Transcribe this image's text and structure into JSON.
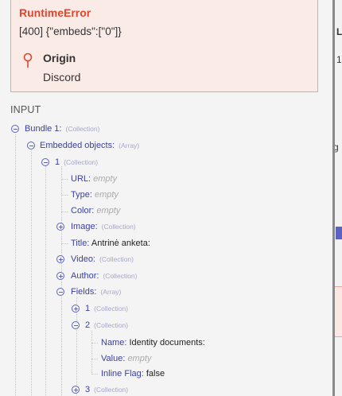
{
  "error": {
    "title": "RuntimeError",
    "message": "[400] {\"embeds\":[\"0\"]}",
    "origin_label": "Origin",
    "origin_value": "Discord",
    "accent_color": "#e0452d"
  },
  "input_label": "INPUT",
  "tree": {
    "bundle": {
      "key": "Bundle 1:",
      "type": "(Collection)"
    },
    "embedded": {
      "key": "Embedded objects:",
      "type": "(Array)"
    },
    "item1": {
      "key": "1",
      "type": "(Collection)"
    },
    "url": {
      "key": "URL:",
      "value": "empty"
    },
    "type_field": {
      "key": "Type:",
      "value": "empty"
    },
    "color": {
      "key": "Color:",
      "value": "empty"
    },
    "image": {
      "key": "Image:",
      "type": "(Collection)"
    },
    "title": {
      "key": "Title:",
      "value": "Antrinė anketa:"
    },
    "video": {
      "key": "Video:",
      "type": "(Collection)"
    },
    "author": {
      "key": "Author:",
      "type": "(Collection)"
    },
    "fields": {
      "key": "Fields:",
      "type": "(Array)"
    },
    "field1": {
      "key": "1",
      "type": "(Collection)"
    },
    "field2": {
      "key": "2",
      "type": "(Collection)"
    },
    "name": {
      "key": "Name:",
      "value": "Identity documents:"
    },
    "value_field": {
      "key": "Value:",
      "value": "empty"
    },
    "inline": {
      "key": "Inline Flag:",
      "value": "false"
    },
    "field3": {
      "key": "3",
      "type": "(Collection)"
    }
  },
  "right_panel": {
    "text1": "L",
    "text2": "1",
    "text3": "g"
  }
}
